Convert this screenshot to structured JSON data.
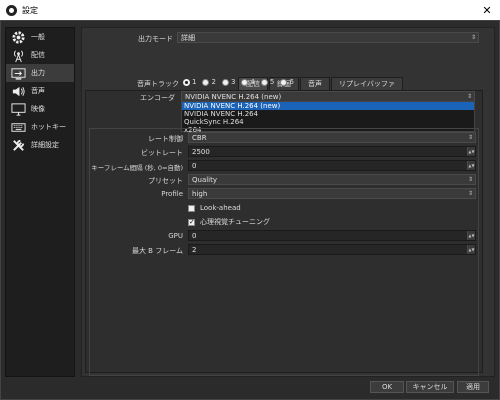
{
  "window": {
    "title": "設定",
    "close_glyph": "✕"
  },
  "sidebar": {
    "items": [
      {
        "label": "一般",
        "icon": "gear-icon"
      },
      {
        "label": "配信",
        "icon": "broadcast-icon"
      },
      {
        "label": "出力",
        "icon": "output-icon"
      },
      {
        "label": "音声",
        "icon": "speaker-icon"
      },
      {
        "label": "映像",
        "icon": "monitor-icon"
      },
      {
        "label": "ホットキー",
        "icon": "keyboard-icon"
      },
      {
        "label": "詳細設定",
        "icon": "tools-icon"
      }
    ],
    "active_index": 2
  },
  "output": {
    "mode_label": "出力モード",
    "mode_value": "詳細",
    "tabs": [
      "配信",
      "録画",
      "音声",
      "リプレイバッファ"
    ],
    "active_tab": 0,
    "audio_track_label": "音声トラック",
    "audio_tracks": [
      "1",
      "2",
      "3",
      "4",
      "5",
      "6"
    ],
    "audio_track_selected": 0,
    "encoder_label": "エンコーダ",
    "encoder_value": "NVIDIA NVENC H.264 (new)",
    "encoder_options": [
      "NVIDIA NVENC H.264 (new)",
      "NVIDIA NVENC H.264",
      "QuickSync H.264",
      "x264"
    ],
    "encoder_selected_index": 0,
    "rate_control_label": "レート制御",
    "rate_control_value": "CBR",
    "bitrate_label": "ビットレート",
    "bitrate_value": "2500",
    "keyframe_label": "キーフレーム間隔 (秒, 0=自動)",
    "keyframe_value": "0",
    "preset_label": "プリセット",
    "preset_value": "Quality",
    "profile_label": "Profile",
    "profile_value": "high",
    "lookahead_label": "Look-ahead",
    "lookahead_checked": false,
    "psycho_label": "心理視覚チューニング",
    "psycho_checked": true,
    "gpu_label": "GPU",
    "gpu_value": "0",
    "bframes_label": "最大 B フレーム",
    "bframes_value": "2"
  },
  "footer": {
    "ok": "OK",
    "cancel": "キャンセル",
    "apply": "適用"
  }
}
